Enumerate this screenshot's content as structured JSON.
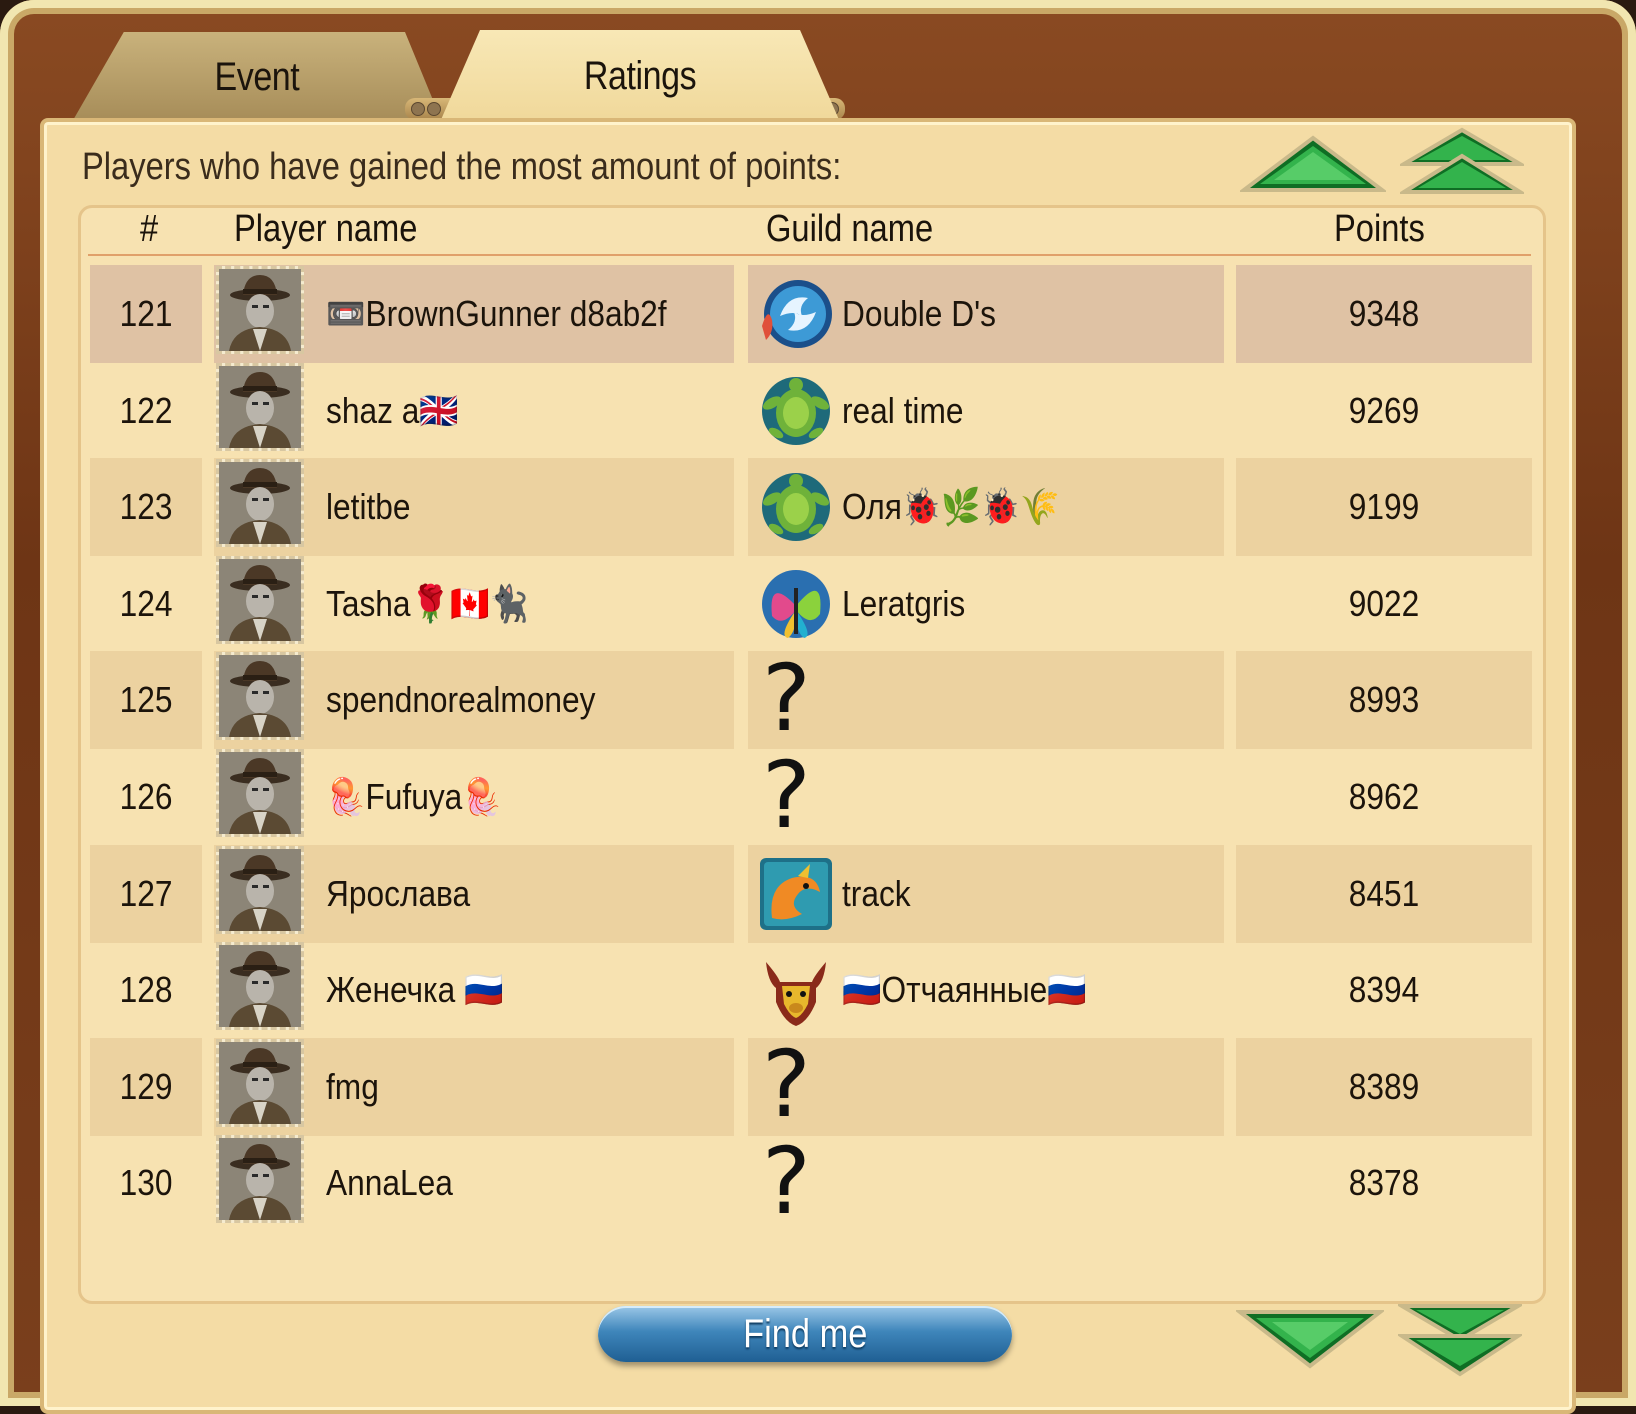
{
  "tabs": [
    {
      "label": "Event",
      "active": false
    },
    {
      "label": "Ratings",
      "active": true
    }
  ],
  "headline": "Players who have gained the most amount of points:",
  "columns": {
    "rank": "#",
    "player": "Player name",
    "guild": "Guild name",
    "points": "Points"
  },
  "rows": [
    {
      "rank": "121",
      "player": "📼BrownGunner d8ab2f",
      "guild": "Double D's",
      "guild_icon": "dolphin-emblem-icon",
      "points": "9348",
      "highlighted": true
    },
    {
      "rank": "122",
      "player": "shaz a🇬🇧",
      "guild": "real time",
      "guild_icon": "turtle-emblem-icon",
      "points": "9269"
    },
    {
      "rank": "123",
      "player": "letitbe",
      "guild": "Оля🐞🌿🐞🌾",
      "guild_icon": "turtle-emblem-icon",
      "points": "9199"
    },
    {
      "rank": "124",
      "player": "Tasha🌹🇨🇦🐈‍⬛",
      "guild": "Leratgris",
      "guild_icon": "butterfly-emblem-icon",
      "points": "9022"
    },
    {
      "rank": "125",
      "player": "spendnorealmoney",
      "guild": "?",
      "guild_icon": "none",
      "points": "8993"
    },
    {
      "rank": "126",
      "player": "🪼Fufuya🪼",
      "guild": "?",
      "guild_icon": "none",
      "points": "8962"
    },
    {
      "rank": "127",
      "player": "Ярослава",
      "guild": "track",
      "guild_icon": "dragon-emblem-icon",
      "points": "8451"
    },
    {
      "rank": "128",
      "player": "Женечка 🇷🇺",
      "guild": "🇷🇺Отчаянные🇷🇺",
      "guild_icon": "bull-emblem-icon",
      "points": "8394"
    },
    {
      "rank": "129",
      "player": "fmg",
      "guild": "?",
      "guild_icon": "none",
      "points": "8389"
    },
    {
      "rank": "130",
      "player": "AnnaLea",
      "guild": "?",
      "guild_icon": "none",
      "points": "8378"
    }
  ],
  "find_button": "Find me",
  "nav_icons": [
    "page-up-icon",
    "jump-top-icon",
    "page-down-icon",
    "jump-bottom-icon"
  ],
  "colors": {
    "accent_green": "#1f9a3a",
    "button_blue": "#2f74a9",
    "panel": "#f4dca5",
    "wood": "#6e3515"
  }
}
